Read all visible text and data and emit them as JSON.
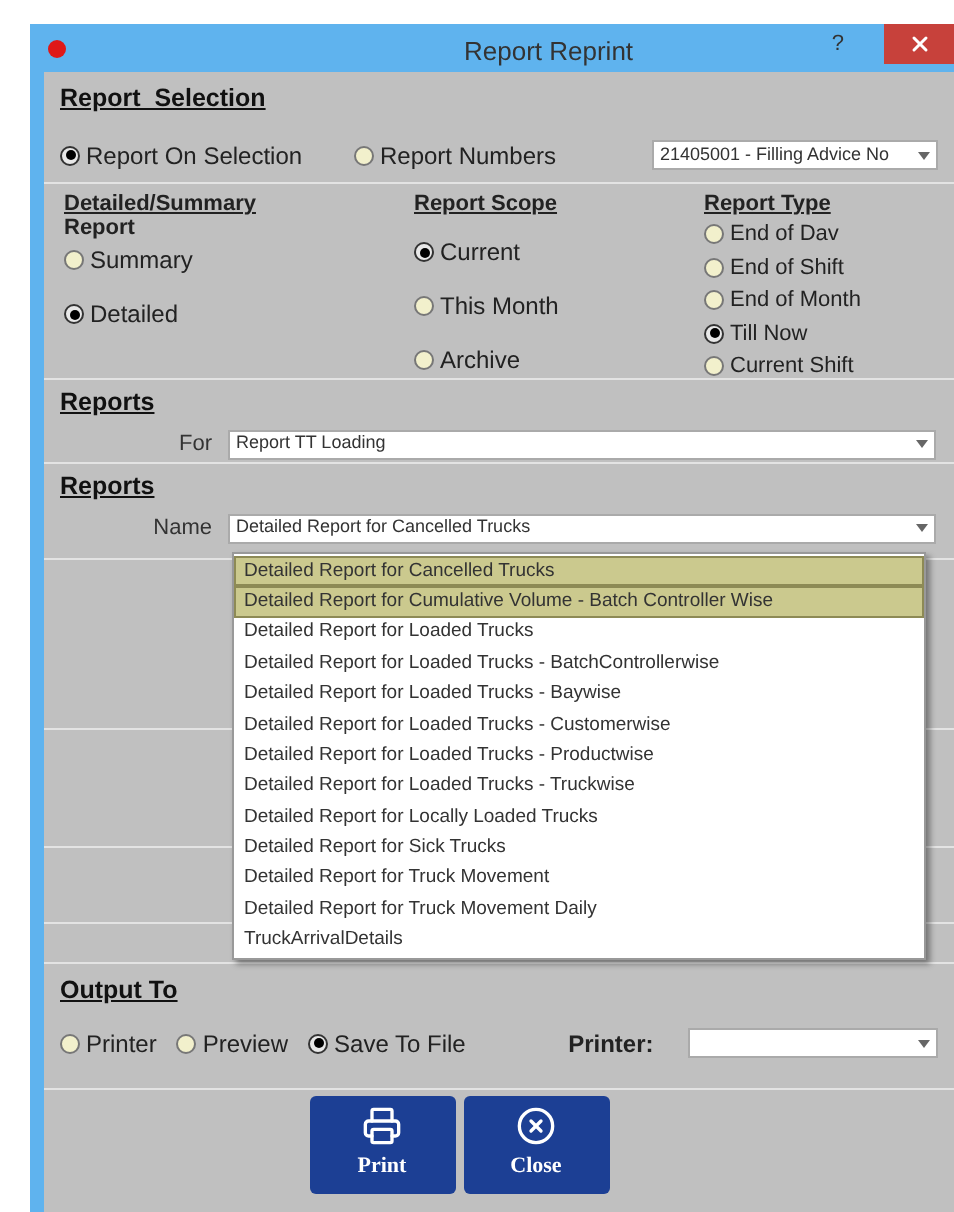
{
  "window": {
    "title": "Report Reprint",
    "help": "?"
  },
  "report_selection": {
    "heading": "Report  Selection",
    "options": [
      {
        "label": "Report On Selection",
        "selected": true
      },
      {
        "label": "Report Numbers",
        "selected": false
      }
    ],
    "report_number": {
      "value": "21405001 - Filling Advice No"
    }
  },
  "groups": [
    {
      "heading": "Detailed/Summary",
      "subheading": "Report",
      "options": [
        {
          "label": "Summary",
          "selected": false
        },
        {
          "label": "Detailed",
          "selected": true
        }
      ]
    },
    {
      "heading": "Report Scope",
      "options": [
        {
          "label": "Current",
          "selected": true
        },
        {
          "label": "This Month",
          "selected": false
        },
        {
          "label": "Archive",
          "selected": false
        }
      ]
    },
    {
      "heading": "Report Type",
      "options": [
        {
          "label": "End of Dav",
          "selected": false
        },
        {
          "label": "End of Shift",
          "selected": false
        },
        {
          "label": "End of Month",
          "selected": false
        },
        {
          "label": "Till Now",
          "selected": true
        },
        {
          "label": "Current Shift",
          "selected": false
        }
      ]
    }
  ],
  "reports_for": {
    "heading": "Reports",
    "label": "For",
    "value": "Report TT Loading"
  },
  "reports_name": {
    "heading": "Reports",
    "label": "Name",
    "value": "Detailed Report for Cancelled Trucks",
    "list": [
      {
        "label": "Detailed Report for Cancelled Trucks",
        "selected": true
      },
      {
        "label": "Detailed Report for Cumulative Volume - Batch Controller Wise",
        "selected": true
      },
      {
        "label": "Detailed Report for Loaded Trucks",
        "selected": false
      },
      {
        "label": "Detailed Report for Loaded Trucks - BatchControllerwise",
        "selected": false
      },
      {
        "label": "Detailed Report for Loaded Trucks - Baywise",
        "selected": false
      },
      {
        "label": "Detailed Report for Loaded Trucks - Customerwise",
        "selected": false
      },
      {
        "label": "Detailed Report for Loaded Trucks - Productwise",
        "selected": false
      },
      {
        "label": "Detailed Report for Loaded Trucks - Truckwise",
        "selected": false
      },
      {
        "label": "Detailed Report for Locally Loaded Trucks",
        "selected": false
      },
      {
        "label": "Detailed Report for Sick Trucks",
        "selected": false
      },
      {
        "label": "Detailed Report for Truck Movement",
        "selected": false
      },
      {
        "label": "Detailed Report for Truck Movement Daily",
        "selected": false
      },
      {
        "label": "TruckArrivalDetails",
        "selected": false
      }
    ]
  },
  "output": {
    "heading": "Output To",
    "options": [
      {
        "label": "Printer",
        "selected": false
      },
      {
        "label": "Preview",
        "selected": false
      },
      {
        "label": "Save To File",
        "selected": true
      }
    ],
    "printer_label": "Printer:"
  },
  "buttons": [
    {
      "label": "Print",
      "kind": "print"
    },
    {
      "label": "Close",
      "kind": "close"
    }
  ]
}
